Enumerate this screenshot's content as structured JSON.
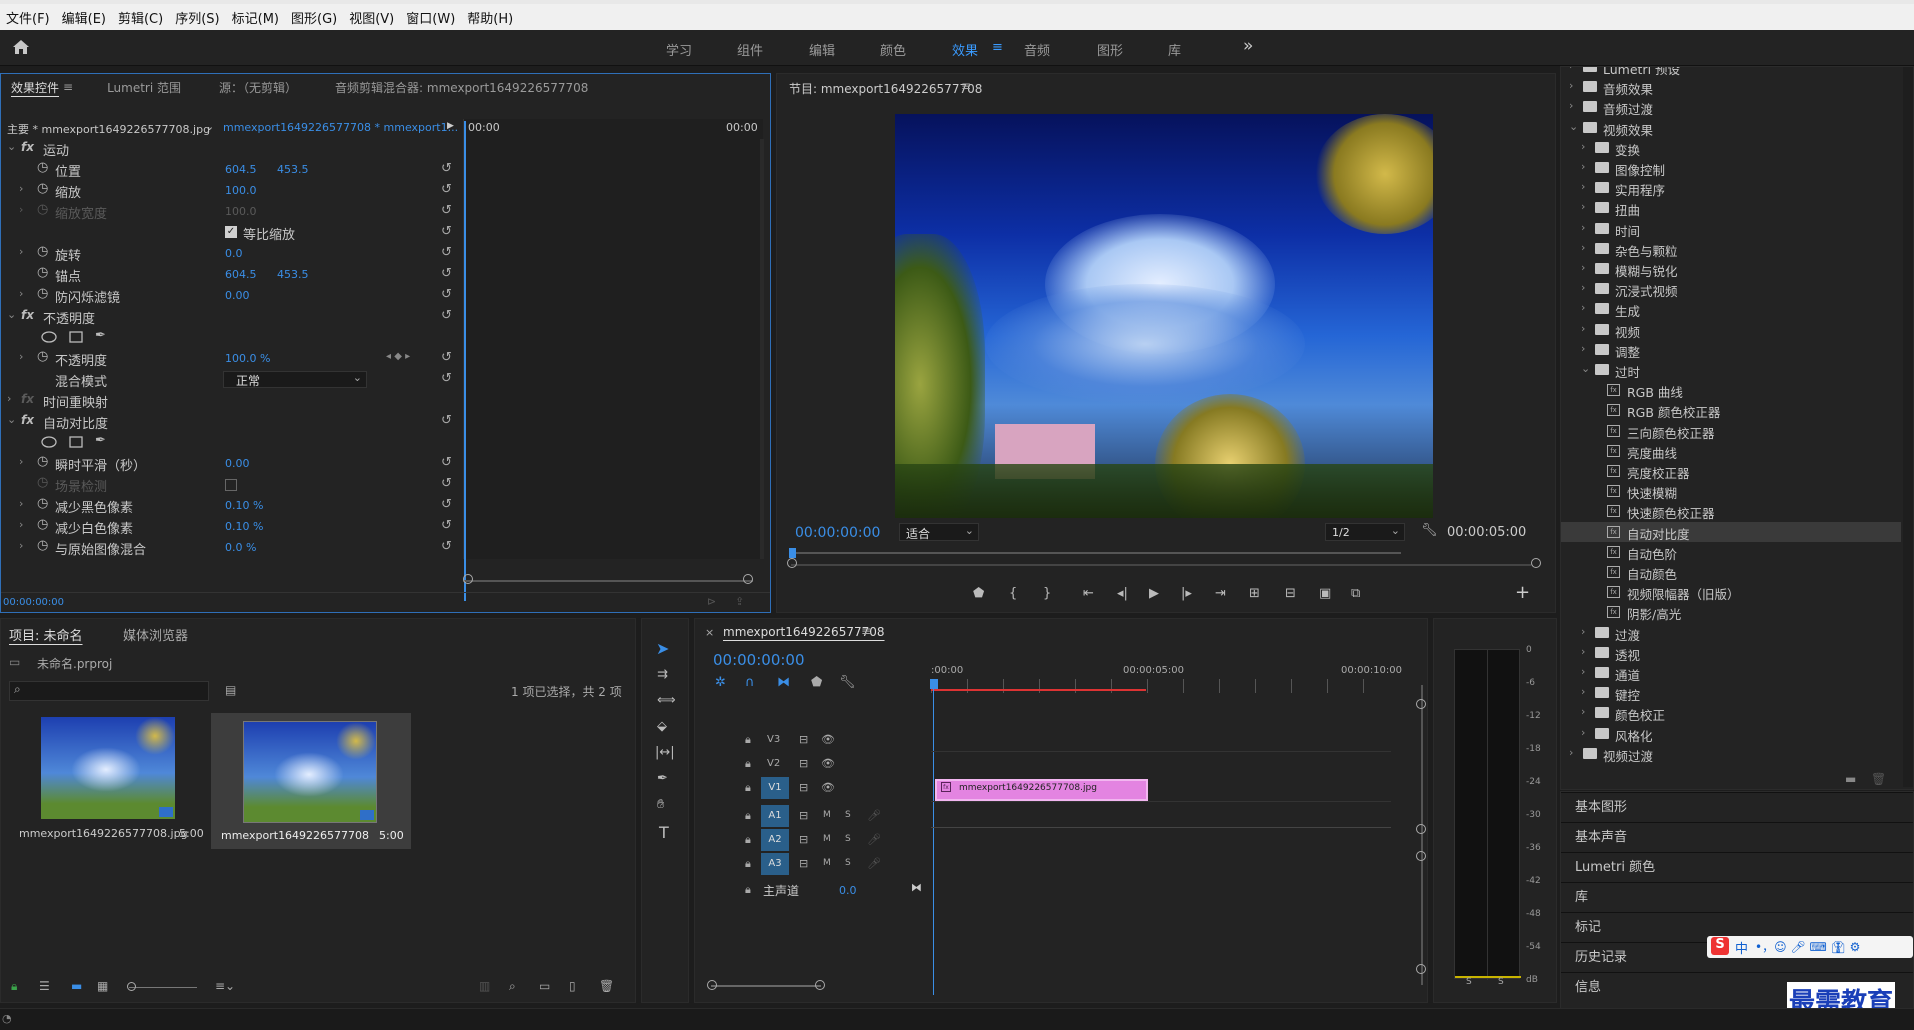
{
  "menu": [
    "文件(F)",
    "编辑(E)",
    "剪辑(C)",
    "序列(S)",
    "标记(M)",
    "图形(G)",
    "视图(V)",
    "窗口(W)",
    "帮助(H)"
  ],
  "workspaces": [
    "学习",
    "组件",
    "编辑",
    "颜色",
    "效果",
    "音频",
    "图形",
    "库"
  ],
  "workspaces_more": "»",
  "effect_controls": {
    "tabs": [
      "效果控件",
      "Lumetri 范围",
      "源：（无剪辑）",
      "音频剪辑混合器: mmexport1649226577708"
    ],
    "master": "主要 * mmexport1649226577708.jpg",
    "clip": "mmexport1649226577708 * mmexport1...",
    "tc_start": "00:00",
    "tc_end": "00:00",
    "sections": {
      "motion": "运动",
      "opacity": "不透明度",
      "time_remap": "时间重映射",
      "auto_contrast": "自动对比度"
    },
    "props": {
      "position": {
        "label": "位置",
        "x": "604.5",
        "y": "453.5"
      },
      "scale": {
        "label": "缩放",
        "v": "100.0"
      },
      "scale_width": {
        "label": "缩放宽度",
        "v": "100.0"
      },
      "uniform": "等比缩放",
      "rotation": {
        "label": "旋转",
        "v": "0.0"
      },
      "anchor": {
        "label": "锚点",
        "x": "604.5",
        "y": "453.5"
      },
      "antiflicker": {
        "label": "防闪烁滤镜",
        "v": "0.00"
      },
      "opacity_val": {
        "label": "不透明度",
        "v": "100.0 %"
      },
      "blend": {
        "label": "混合模式",
        "v": "正常"
      },
      "smooth": {
        "label": "瞬时平滑（秒）",
        "v": "0.00"
      },
      "scene": {
        "label": "场景检测"
      },
      "black": {
        "label": "减少黑色像素",
        "v": "0.10 %"
      },
      "white": {
        "label": "减少白色像素",
        "v": "0.10 %"
      },
      "mix": {
        "label": "与原始图像混合",
        "v": "0.0 %"
      }
    },
    "bottom_tc": "00:00:00:00"
  },
  "program": {
    "title": "节目: mmexport1649226577708",
    "timecode": "00:00:00:00",
    "fit": "适合",
    "res": "1/2",
    "duration": "00:00:05:00"
  },
  "effects_tree": [
    {
      "indent": 0,
      "open": false,
      "label": "Lumetri 预设",
      "type": "folder"
    },
    {
      "indent": 0,
      "open": false,
      "label": "音频效果",
      "type": "folder"
    },
    {
      "indent": 0,
      "open": false,
      "label": "音频过渡",
      "type": "folder"
    },
    {
      "indent": 0,
      "open": true,
      "label": "视频效果",
      "type": "folder"
    },
    {
      "indent": 1,
      "open": false,
      "label": "变换",
      "type": "folder"
    },
    {
      "indent": 1,
      "open": false,
      "label": "图像控制",
      "type": "folder"
    },
    {
      "indent": 1,
      "open": false,
      "label": "实用程序",
      "type": "folder"
    },
    {
      "indent": 1,
      "open": false,
      "label": "扭曲",
      "type": "folder"
    },
    {
      "indent": 1,
      "open": false,
      "label": "时间",
      "type": "folder"
    },
    {
      "indent": 1,
      "open": false,
      "label": "杂色与颗粒",
      "type": "folder"
    },
    {
      "indent": 1,
      "open": false,
      "label": "模糊与锐化",
      "type": "folder"
    },
    {
      "indent": 1,
      "open": false,
      "label": "沉浸式视频",
      "type": "folder"
    },
    {
      "indent": 1,
      "open": false,
      "label": "生成",
      "type": "folder"
    },
    {
      "indent": 1,
      "open": false,
      "label": "视频",
      "type": "folder"
    },
    {
      "indent": 1,
      "open": false,
      "label": "调整",
      "type": "folder"
    },
    {
      "indent": 1,
      "open": true,
      "label": "过时",
      "type": "folder"
    },
    {
      "indent": 2,
      "label": "RGB 曲线",
      "type": "fx"
    },
    {
      "indent": 2,
      "label": "RGB 颜色校正器",
      "type": "fx"
    },
    {
      "indent": 2,
      "label": "三向颜色校正器",
      "type": "fx"
    },
    {
      "indent": 2,
      "label": "亮度曲线",
      "type": "fx"
    },
    {
      "indent": 2,
      "label": "亮度校正器",
      "type": "fx"
    },
    {
      "indent": 2,
      "label": "快速模糊",
      "type": "fx"
    },
    {
      "indent": 2,
      "label": "快速颜色校正器",
      "type": "fx"
    },
    {
      "indent": 2,
      "label": "自动对比度",
      "type": "fx",
      "selected": true
    },
    {
      "indent": 2,
      "label": "自动色阶",
      "type": "fx"
    },
    {
      "indent": 2,
      "label": "自动颜色",
      "type": "fx"
    },
    {
      "indent": 2,
      "label": "视频限幅器（旧版）",
      "type": "fx"
    },
    {
      "indent": 2,
      "label": "阴影/高光",
      "type": "fx"
    },
    {
      "indent": 1,
      "open": false,
      "label": "过渡",
      "type": "folder"
    },
    {
      "indent": 1,
      "open": false,
      "label": "透视",
      "type": "folder"
    },
    {
      "indent": 1,
      "open": false,
      "label": "通道",
      "type": "folder"
    },
    {
      "indent": 1,
      "open": false,
      "label": "键控",
      "type": "folder"
    },
    {
      "indent": 1,
      "open": false,
      "label": "颜色校正",
      "type": "folder"
    },
    {
      "indent": 1,
      "open": false,
      "label": "风格化",
      "type": "folder"
    },
    {
      "indent": 0,
      "open": false,
      "label": "视频过渡",
      "type": "folder"
    }
  ],
  "side_panels": [
    "基本图形",
    "基本声音",
    "Lumetri 颜色",
    "库",
    "标记",
    "历史记录",
    "信息"
  ],
  "project": {
    "tabs": [
      "项目: 未命名",
      "媒体浏览器"
    ],
    "file": "未命名.prproj",
    "selection": "1 项已选择，共 2 项",
    "items": [
      {
        "name": "mmexport1649226577708.jpg",
        "dur": "5:00"
      },
      {
        "name": "mmexport1649226577708",
        "dur": "5:00"
      }
    ]
  },
  "timeline": {
    "title": "mmexport1649226577708",
    "timecode": "00:00:00:00",
    "ruler": [
      ":00:00",
      "00:00:05:00",
      "00:00:10:00"
    ],
    "video_tracks": [
      "V3",
      "V2",
      "V1"
    ],
    "audio_tracks": [
      "A1",
      "A2",
      "A3"
    ],
    "master": "主声道",
    "master_val": "0.0",
    "clip": "mmexport1649226577708.jpg",
    "m": "M",
    "s": "S"
  },
  "meter": {
    "scale": [
      "0",
      "-6",
      "-12",
      "-18",
      "-24",
      "-30",
      "-36",
      "-42",
      "-48",
      "-54",
      "dB"
    ],
    "s": "S"
  },
  "ime": "中",
  "watermark": "最需教育",
  "colors": {
    "accent": "#3a8ee6",
    "clip": "#e384e1",
    "playhead": "#3a8ee6",
    "selected_bg": "#3a3a3a"
  }
}
